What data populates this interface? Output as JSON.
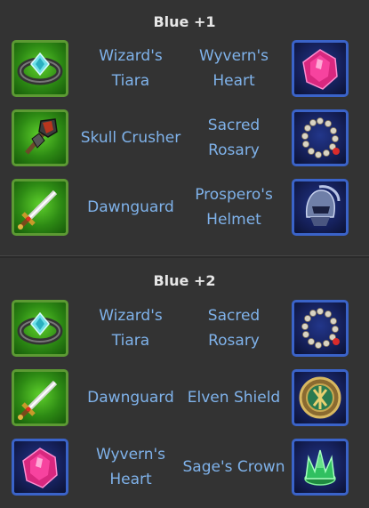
{
  "sections": [
    {
      "title": "Blue +1",
      "rows": [
        {
          "left": {
            "name": "Wizard's\nTiara",
            "icon": "wizards-tiara-icon",
            "frame": "green"
          },
          "right": {
            "name": "Wyvern's\nHeart",
            "icon": "wyverns-heart-icon",
            "frame": "blue"
          }
        },
        {
          "left": {
            "name": "Skull Crusher",
            "icon": "skull-crusher-icon",
            "frame": "green"
          },
          "right": {
            "name": "Sacred\nRosary",
            "icon": "sacred-rosary-icon",
            "frame": "blue"
          }
        },
        {
          "left": {
            "name": "Dawnguard",
            "icon": "dawnguard-icon",
            "frame": "green"
          },
          "right": {
            "name": "Prospero's\nHelmet",
            "icon": "prosperos-helmet-icon",
            "frame": "blue"
          }
        }
      ]
    },
    {
      "title": "Blue +2",
      "rows": [
        {
          "left": {
            "name": "Wizard's\nTiara",
            "icon": "wizards-tiara-icon",
            "frame": "green"
          },
          "right": {
            "name": "Sacred\nRosary",
            "icon": "sacred-rosary-icon",
            "frame": "blue"
          }
        },
        {
          "left": {
            "name": "Dawnguard",
            "icon": "dawnguard-icon",
            "frame": "green"
          },
          "right": {
            "name": "Elven Shield",
            "icon": "elven-shield-icon",
            "frame": "blue"
          }
        },
        {
          "left": {
            "name": "Wyvern's\nHeart",
            "icon": "wyverns-heart-icon",
            "frame": "blue"
          },
          "right": {
            "name": "Sage's Crown",
            "icon": "sages-crown-icon",
            "frame": "blue"
          }
        }
      ]
    }
  ],
  "colors": {
    "background": "#333333",
    "title": "#e6e6e6",
    "item_name": "#7fb2ea",
    "green_frame": "#5c9a33",
    "blue_frame": "#3a63c9"
  }
}
